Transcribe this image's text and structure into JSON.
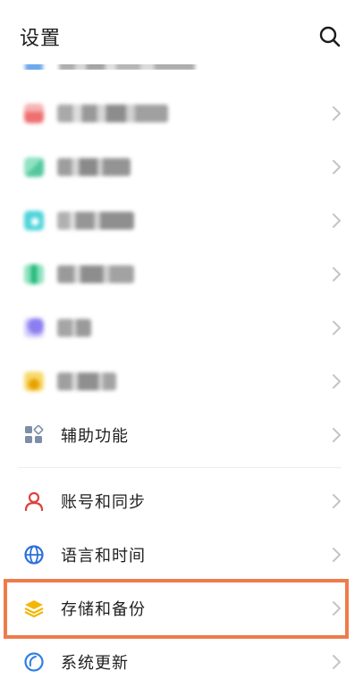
{
  "header": {
    "title": "设置",
    "search_icon": "search-icon"
  },
  "rows": [
    {
      "id": "blurred-1",
      "icon": "red-app-icon",
      "color": "#f08a8a",
      "blurred": true
    },
    {
      "id": "blurred-2",
      "icon": "green-app-icon",
      "color": "#6ed4b0",
      "blurred": true
    },
    {
      "id": "blurred-3",
      "icon": "teal-app-icon",
      "color": "#49d0d8",
      "blurred": true
    },
    {
      "id": "blurred-4",
      "icon": "green-app-icon",
      "color": "#3ec98e",
      "blurred": true
    },
    {
      "id": "blurred-5",
      "icon": "purple-app-icon",
      "color": "#a99af0",
      "blurred": true
    },
    {
      "id": "blurred-6",
      "icon": "yellow-app-icon",
      "color": "#f2c64a",
      "blurred": true
    },
    {
      "id": "accessibility",
      "label": "辅助功能",
      "icon": "accessibility-icon",
      "color": "#7d8ea8"
    },
    {
      "id": "account-sync",
      "label": "账号和同步",
      "icon": "person-icon",
      "color": "#e0413a"
    },
    {
      "id": "language-time",
      "label": "语言和时间",
      "icon": "globe-icon",
      "color": "#2d6fd9"
    },
    {
      "id": "storage-backup",
      "label": "存储和备份",
      "icon": "stack-layers-icon",
      "color": "#f2b705"
    },
    {
      "id": "system-update",
      "label": "系统更新",
      "icon": "update-icon",
      "color": "#2e7fe0"
    }
  ],
  "highlight": {
    "target": "storage-backup",
    "color": "#ee7c4a"
  }
}
